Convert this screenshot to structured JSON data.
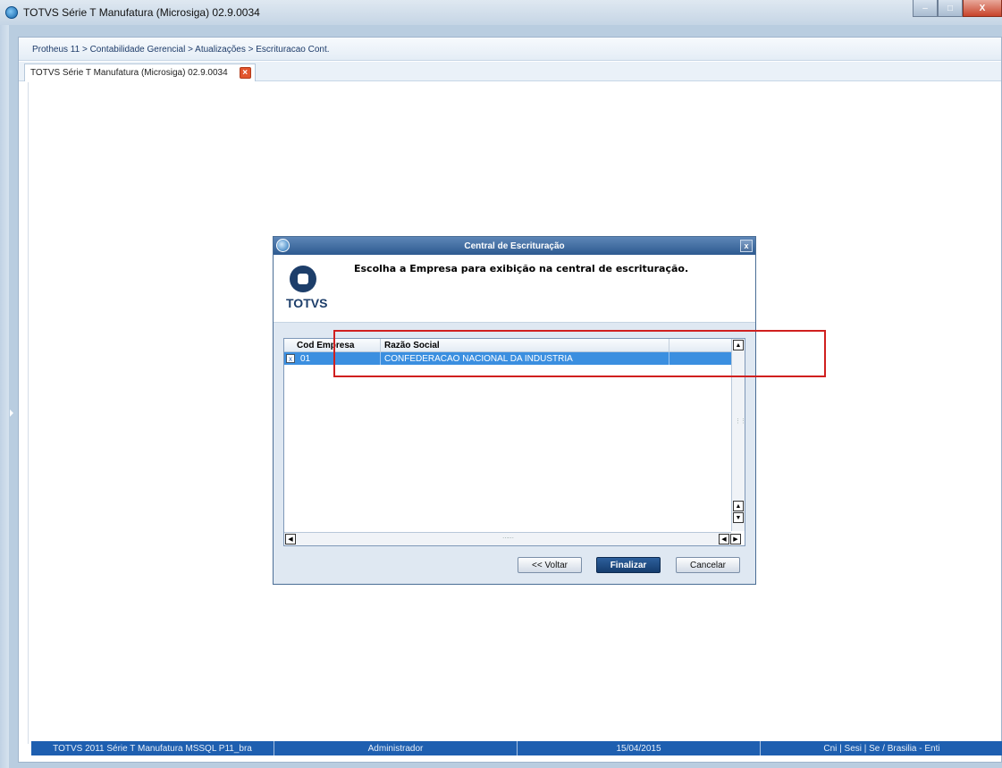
{
  "window": {
    "title": "TOTVS Série T Manufatura (Microsiga) 02.9.0034"
  },
  "window_controls": {
    "minimize": "–",
    "maximize": "□",
    "close": "X"
  },
  "breadcrumb": "Protheus 11 > Contabilidade Gerencial > Atualizações > Escrituracao Cont.",
  "tab": {
    "label": "TOTVS Série T Manufatura (Microsiga) 02.9.0034",
    "close": "×"
  },
  "dialog": {
    "title": "Central de Escrituração",
    "close": "x",
    "heading": "Escolha a Empresa para exibição na central de escrituração.",
    "logo_text": "TOTVS",
    "grid": {
      "columns": [
        "Cod Empresa",
        "Razão Social"
      ],
      "rows": [
        {
          "checked": true,
          "mark": "x",
          "cod": "01",
          "razao": "CONFEDERACAO NACIONAL DA INDUSTRIA"
        }
      ]
    },
    "buttons": {
      "back": "<< Voltar",
      "finish": "Finalizar",
      "cancel": "Cancelar"
    }
  },
  "statusbar": {
    "product": "TOTVS 2011 Série T Manufatura MSSQL P11_bra",
    "user": "Administrador",
    "date": "15/04/2015",
    "company": "Cni | Sesi | Se / Brasilia - Enti"
  },
  "colors": {
    "accent": "#1e5fb0",
    "selection": "#3b8fe0",
    "annotation": "#d0201f"
  },
  "icons": [
    "totvs-app-icon",
    "close-icon",
    "checkbox-icon",
    "scroll-up-icon",
    "scroll-down-icon",
    "scroll-left-icon",
    "scroll-right-icon",
    "chevron-right-icon"
  ]
}
